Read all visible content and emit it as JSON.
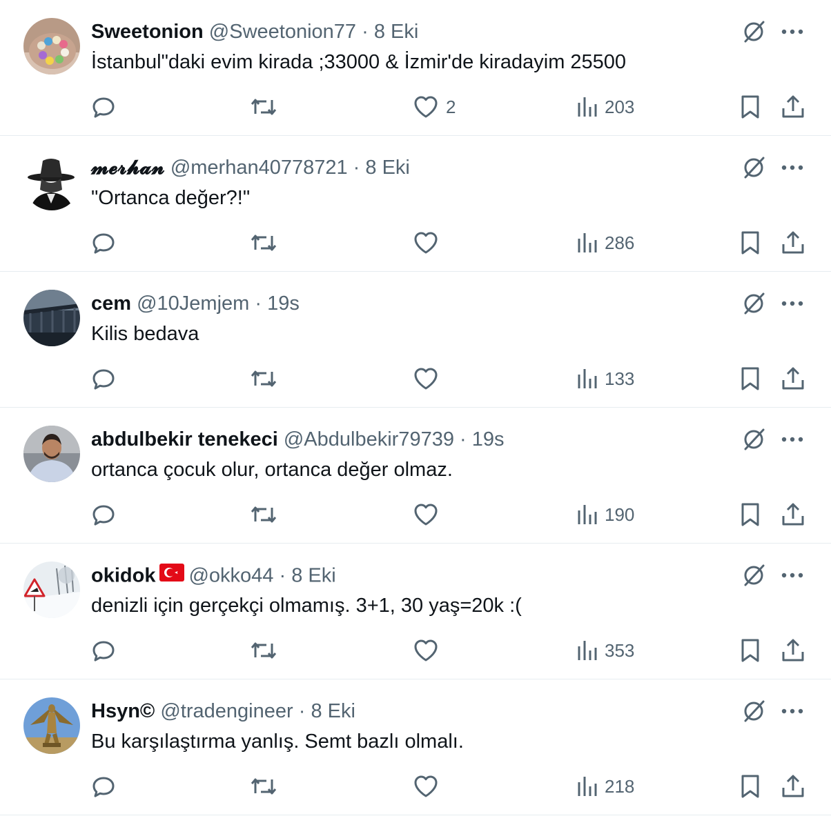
{
  "tweets": [
    {
      "name": "Sweetonion",
      "handle": "@Sweetonion77",
      "sep": "·",
      "time": "8 Eki",
      "text": "İstanbul\"daki evim kirada ;33000 & İzmir'de kiradayim 25500",
      "likes": "2",
      "views": "203",
      "avatar": "bead-bracelet"
    },
    {
      "name": "𝓶𝓮𝓻𝓱𝓪𝓷",
      "handle": "@merhan40778721",
      "sep": "·",
      "time": "8 Eki",
      "text": "\"Ortanca değer?!\"",
      "likes": "",
      "views": "286",
      "avatar": "hat-silhouette"
    },
    {
      "name": "cem",
      "handle": "@10Jemjem",
      "sep": "·",
      "time": "19s",
      "text": "Kilis bedava",
      "likes": "",
      "views": "133",
      "avatar": "bridge-photo"
    },
    {
      "name": "abdulbekir tenekeci",
      "handle": "@Abdulbekir79739",
      "sep": "·",
      "time": "19s",
      "text": "ortanca çocuk olur, ortanca değer olmaz.",
      "likes": "",
      "views": "190",
      "avatar": "man-portrait"
    },
    {
      "name": "okidok",
      "handle": "@okko44",
      "sep": "·",
      "time": "8 Eki",
      "text": "denizli için gerçekçi olmamış. 3+1, 30 yaş=20k :(",
      "likes": "",
      "views": "353",
      "avatar": "snow-sign",
      "flag": "turkey-flag"
    },
    {
      "name": "Hsyn©",
      "handle": "@tradengineer",
      "sep": "·",
      "time": "8 Eki",
      "text": "Bu karşılaştırma yanlış. Semt bazlı olmalı.",
      "likes": "",
      "views": "218",
      "avatar": "winged-statue"
    }
  ],
  "colors": {
    "text": "#0f1419",
    "secondary": "#536471",
    "divider": "#e6ecf0",
    "flag_red": "#e30a17"
  }
}
